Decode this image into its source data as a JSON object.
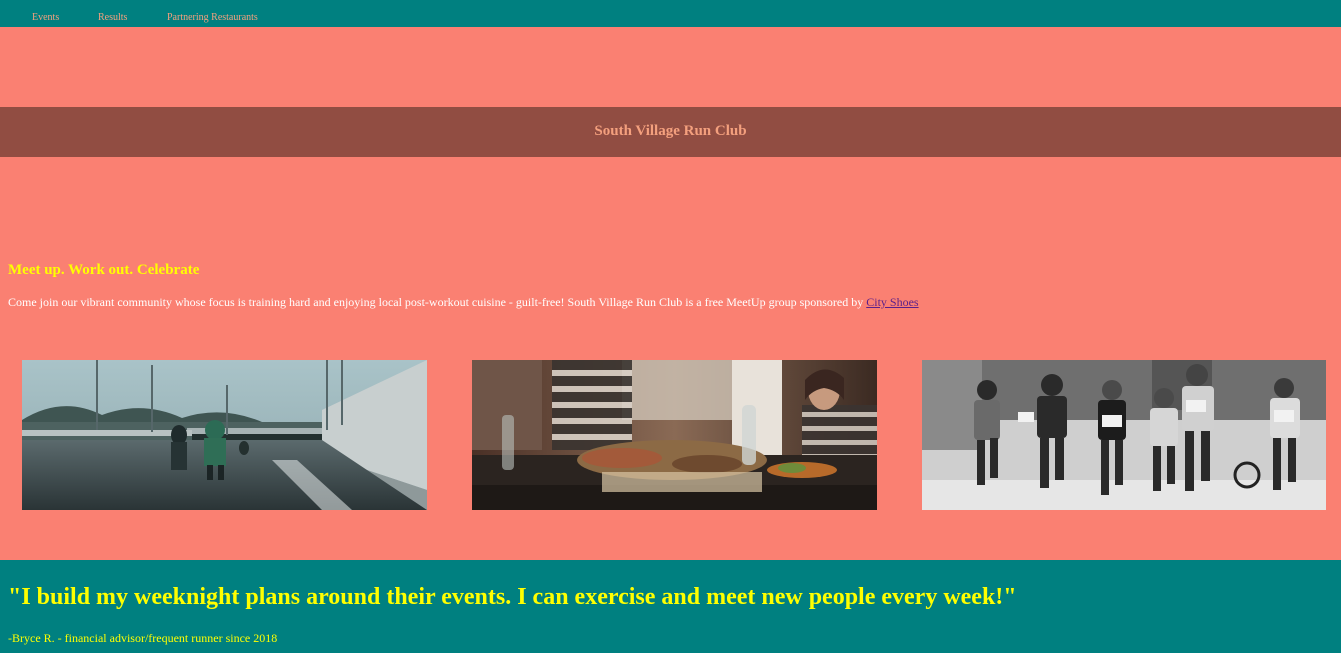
{
  "nav": {
    "links": [
      {
        "label": "Events"
      },
      {
        "label": "Results"
      },
      {
        "label": "Partnering Restaurants"
      }
    ]
  },
  "header": {
    "title": "South Village Run Club"
  },
  "intro": {
    "heading": "Meet up. Work out. Celebrate",
    "text": "Come join our vibrant community whose focus is training hard and enjoying local post-workout cuisine - guilt-free! South Village Run Club is a free MeetUp group sponsored by ",
    "sponsor_link": "City Shoes"
  },
  "gallery": {
    "images": [
      {
        "subject": "runners-in-underpass-photo"
      },
      {
        "subject": "friends-dining-photo"
      },
      {
        "subject": "marathon-runners-photo"
      }
    ]
  },
  "testimonial": {
    "quote": "\"I build my weeknight plans around their events. I can exercise and meet new people every week!\"",
    "attribution": "-Bryce R. - financial advisor/frequent runner since 2018"
  },
  "colors": {
    "page_background": "#fa8072",
    "nav_background": "#008080",
    "banner_background": "#914d42",
    "title_text": "#f4a07e",
    "heading_text": "#ffff00",
    "body_text": "#ffffff"
  }
}
